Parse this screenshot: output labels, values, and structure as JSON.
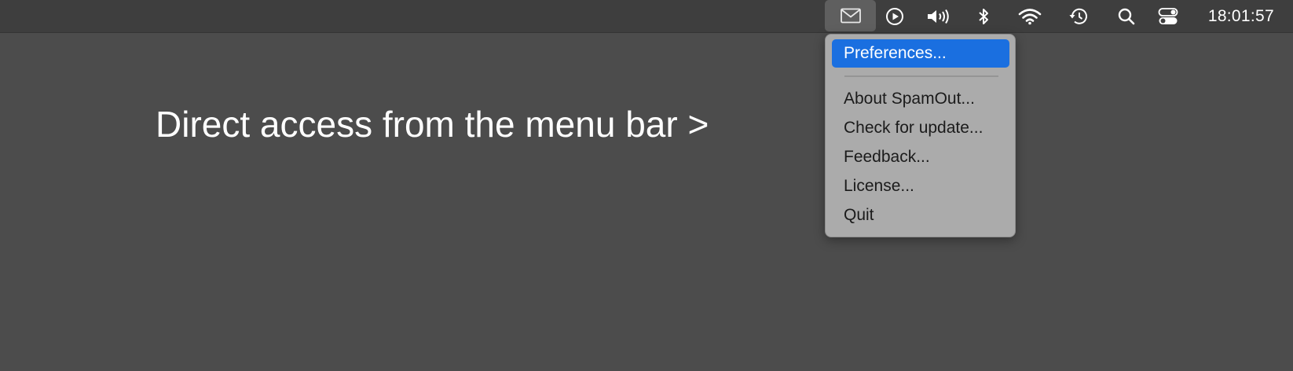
{
  "menubar": {
    "icons": [
      "mail-icon",
      "play-circle-icon",
      "speaker-icon",
      "bluetooth-icon",
      "wifi-icon",
      "time-machine-icon",
      "search-icon",
      "control-center-icon"
    ],
    "clock": "18:01:57"
  },
  "headline": "Direct access from the menu bar >",
  "menu": {
    "items": [
      {
        "label": "Preferences...",
        "selected": true
      },
      {
        "label": "About SpamOut..."
      },
      {
        "label": "Check for update..."
      },
      {
        "label": "Feedback..."
      },
      {
        "label": "License..."
      },
      {
        "label": "Quit"
      }
    ]
  },
  "colors": {
    "background": "#4c4c4c",
    "menubar": "#3e3e3e",
    "menu": "#ababab",
    "selection": "#1a6fe0"
  }
}
